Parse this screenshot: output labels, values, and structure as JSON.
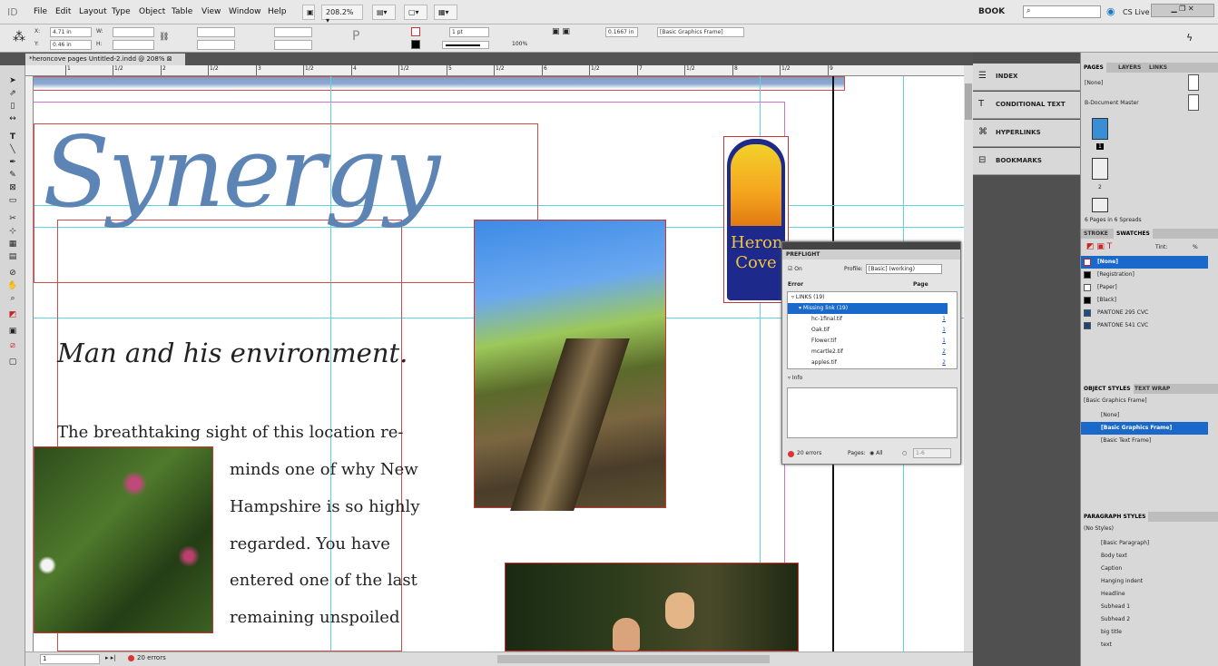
{
  "app": {
    "logo": "ID"
  },
  "menubar": {
    "items": [
      "File",
      "Edit",
      "Layout",
      "Type",
      "Object",
      "Table",
      "View",
      "Window",
      "Help"
    ],
    "zoom": "208.2%",
    "workspace": "BOOK",
    "cslive": "CS Live"
  },
  "control": {
    "x_label": "X:",
    "x": "4.71 in",
    "y_label": "Y:",
    "y": "0.46 in",
    "w_label": "W:",
    "h_label": "H:",
    "stroke_weight": "1 pt",
    "scale": "100%",
    "inset": "0.1667 in",
    "object_style": "[Basic Graphics Frame]"
  },
  "document": {
    "tab_title": "*heroncove pages Untitled-2.indd @ 208%"
  },
  "ruler": {
    "labels": [
      "1",
      "1/2",
      "2",
      "1/2",
      "3",
      "1/2",
      "4",
      "1/2",
      "5",
      "1/2",
      "6",
      "1/2",
      "7",
      "1/2",
      "8",
      "1/2",
      "9"
    ]
  },
  "page": {
    "headline": "Synergy",
    "subhead": "Man and his environment.",
    "body_first": "The breathtaking sight of this location re-",
    "body_lines": [
      "minds one of why New",
      "Hampshire is so highly",
      "regarded.  You have",
      "entered one of the last",
      "remaining unspoiled"
    ],
    "logo_line1": "Heron",
    "logo_line2": "Cove"
  },
  "status": {
    "page": "1",
    "errors": "20 errors"
  },
  "collapsed_panels": [
    {
      "icon": "index-icon",
      "label": "INDEX"
    },
    {
      "icon": "conditional-text-icon",
      "label": "CONDITIONAL TEXT"
    },
    {
      "icon": "hyperlinks-icon",
      "label": "HYPERLINKS"
    },
    {
      "icon": "bookmarks-icon",
      "label": "BOOKMARKS"
    }
  ],
  "pages_panel": {
    "tabs": [
      "PAGES",
      "LAYERS",
      "LINKS"
    ],
    "none": "[None]",
    "master": "B-Document Master",
    "page_numbers": [
      "1",
      "2"
    ],
    "footer": "6 Pages in 6 Spreads"
  },
  "swatches_panel": {
    "tabs": [
      "STROKE",
      "SWATCHES"
    ],
    "tint": "Tint:",
    "tint_value": "%",
    "items": [
      "[None]",
      "[Registration]",
      "[Paper]",
      "[Black]",
      "PANTONE 295 CVC",
      "PANTONE 541 CVC"
    ],
    "colors": [
      "#ffffff",
      "#000000",
      "#ffffff",
      "#000000",
      "#1b4f8a",
      "#1c4476"
    ]
  },
  "object_styles_panel": {
    "tabs": [
      "OBJECT STYLES",
      "TEXT WRAP"
    ],
    "current": "[Basic Graphics Frame]",
    "items": [
      "[None]",
      "[Basic Graphics Frame]",
      "[Basic Text Frame]"
    ]
  },
  "paragraph_styles_panel": {
    "title": "PARAGRAPH STYLES",
    "current": "(No Styles)",
    "items": [
      "[Basic Paragraph]",
      "Body text",
      "Caption",
      "Hanging indent",
      "Headline",
      "Subhead 1",
      "Subhead 2",
      "big title",
      "text"
    ]
  },
  "preflight": {
    "title": "PREFLIGHT",
    "on": "On",
    "profile_label": "Profile:",
    "profile": "[Basic] (working)",
    "col_error": "Error",
    "col_page": "Page",
    "group": "LINKS (19)",
    "subgroup": "Missing link (19)",
    "rows": [
      {
        "name": "hc-1final.tif",
        "page": "1"
      },
      {
        "name": "Oak.tif",
        "page": "1"
      },
      {
        "name": "Flower.tif",
        "page": "1"
      },
      {
        "name": "mcartle2.tif",
        "page": "2"
      },
      {
        "name": "apples.tif",
        "page": "2"
      }
    ],
    "info": "Info",
    "errors": "20 errors",
    "pages_label": "Pages:",
    "all": "All",
    "range": "1-6"
  }
}
